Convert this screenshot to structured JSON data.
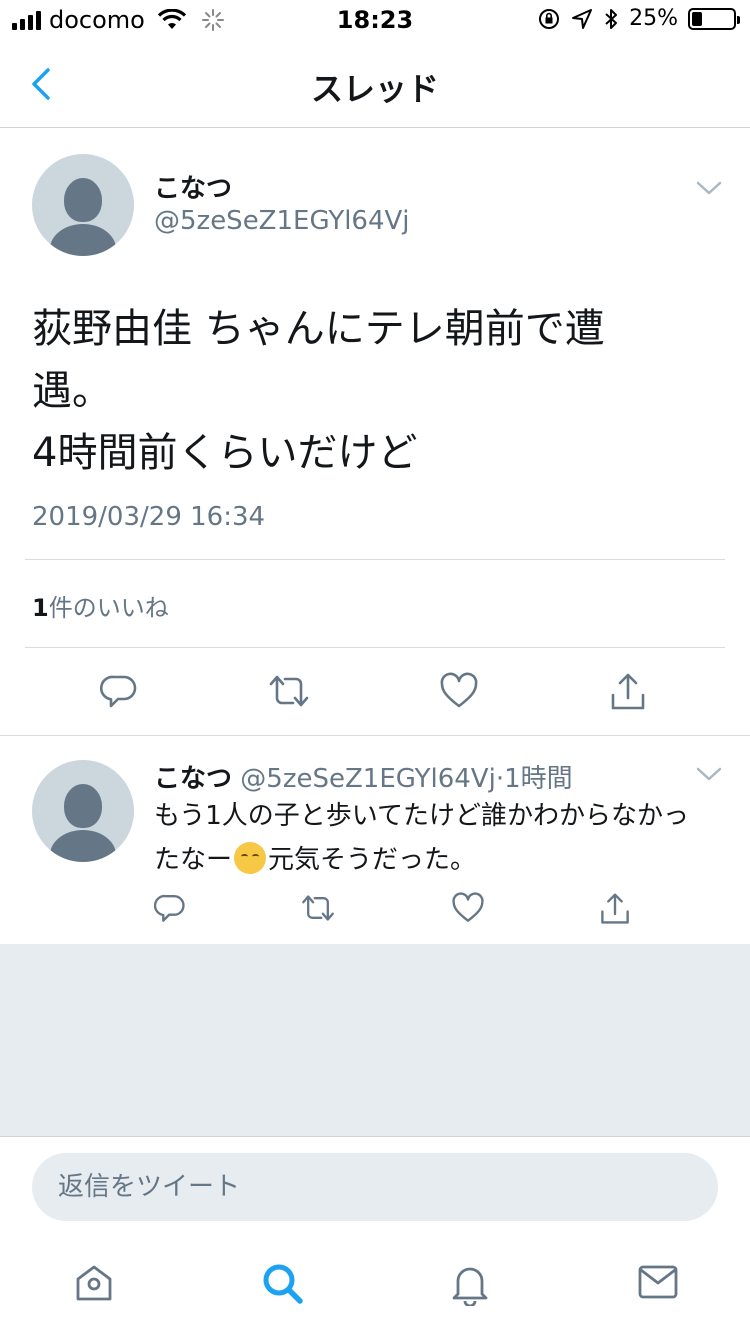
{
  "status_bar": {
    "carrier": "docomo",
    "time": "18:23",
    "battery_percent_label": "25%",
    "battery_level": 0.25
  },
  "nav": {
    "title": "スレッド",
    "accent_color": "#1da1f2"
  },
  "main_tweet": {
    "display_name": "こなつ",
    "handle": "@5zeSeZ1EGYl64Vj",
    "text": "荻野由佳 ちゃんにテレ朝前で遭\n遇。\n4時間前くらいだけど",
    "timestamp": "2019/03/29 16:34",
    "like_count": "1",
    "like_label": "件のいいね",
    "actions": [
      "reply-icon",
      "retweet-icon",
      "like-icon",
      "share-icon"
    ]
  },
  "reply_tweet": {
    "display_name": "こなつ",
    "handle": "@5zeSeZ1EGYl64Vj",
    "separator": "·",
    "time_ago": "1時間",
    "text_before_emoji": "もう1人の子と歩いてたけど誰かわからなかったなー",
    "emoji": "pensive-face-emoji",
    "text_after_emoji": "元気そうだった。",
    "actions": [
      "reply-icon",
      "retweet-icon",
      "like-icon",
      "share-icon"
    ]
  },
  "reply_bar": {
    "placeholder": "返信をツイート"
  },
  "tab_bar": {
    "items": [
      "home-icon",
      "search-icon",
      "notifications-icon",
      "messages-icon"
    ],
    "active": "search-icon"
  }
}
